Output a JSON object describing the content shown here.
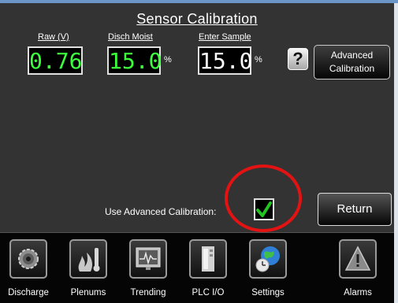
{
  "screen": {
    "title": "Sensor Calibration"
  },
  "readouts": {
    "raw": {
      "label": "Raw (V)",
      "value": "0.76"
    },
    "disch_moist": {
      "label": "Disch Moist",
      "value": "15.0",
      "unit": "%"
    },
    "enter_sample": {
      "label": "Enter Sample",
      "value": "15.0",
      "unit": "%"
    }
  },
  "buttons": {
    "help": "?",
    "advanced_calibration_line1": "Advanced",
    "advanced_calibration_line2": "Calibration",
    "return": "Return"
  },
  "advanced_toggle": {
    "label": "Use Advanced Calibration:",
    "checked": true
  },
  "nav": [
    {
      "label": "Discharge",
      "icon": "gear-icon"
    },
    {
      "label": "Plenums",
      "icon": "flame-thermometer-icon"
    },
    {
      "label": "Trending",
      "icon": "monitor-graph-icon"
    },
    {
      "label": "PLC I/O",
      "icon": "plc-cabinet-icon"
    },
    {
      "label": "Settings",
      "icon": "globe-clock-icon"
    },
    {
      "label": "Alarms",
      "icon": "warning-icon"
    }
  ],
  "colors": {
    "panel_bg": "#333333",
    "readout_green": "#3cff3c",
    "highlight_circle": "#e31313",
    "check_green": "#22c422"
  }
}
